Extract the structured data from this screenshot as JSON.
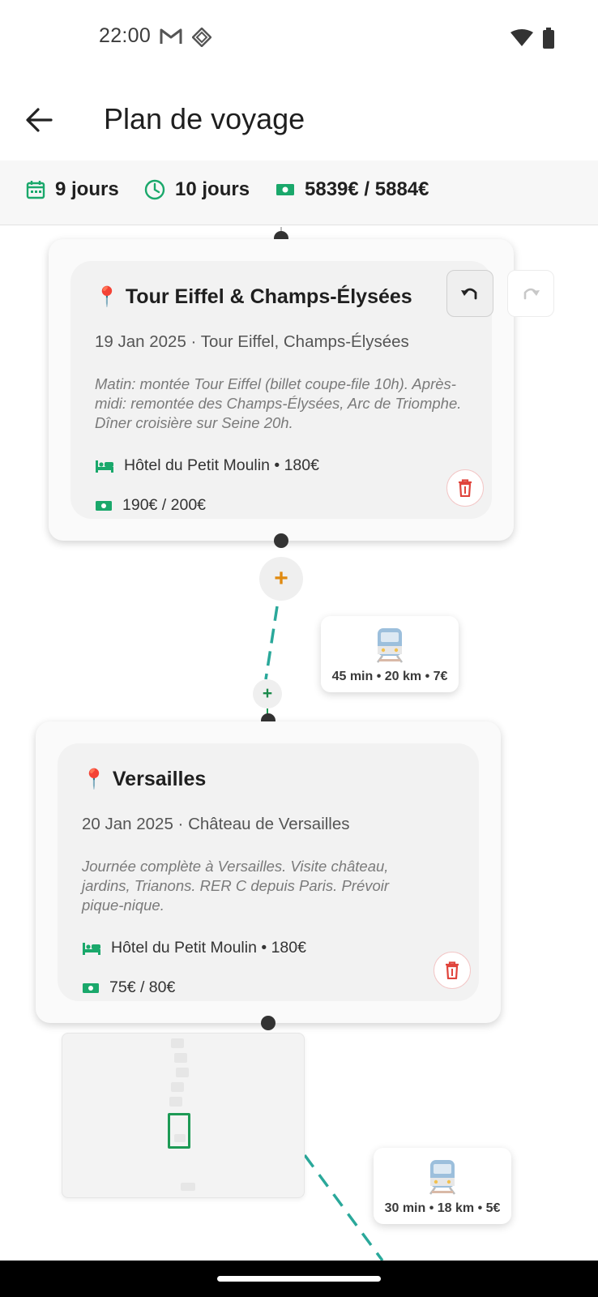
{
  "status_bar": {
    "time": "22:00"
  },
  "app_bar": {
    "title": "Plan de voyage"
  },
  "summary": {
    "days": "9 jours",
    "duration": "10 jours",
    "budget": "5839€ / 5884€",
    "colors": {
      "icon_green": "#1aa86b"
    }
  },
  "days": [
    {
      "title": "Tour Eiffel & Champs-Élysées",
      "meta": "19 Jan 2025 · Tour Eiffel, Champs-Élysées",
      "notes": "Matin: montée Tour Eiffel (billet coupe-file 10h). Après-midi: remontée des Champs-Élysées, Arc de Triomphe. Dîner croisière sur Seine 20h.",
      "hotel": "Hôtel du Petit Moulin • 180€",
      "budget": "190€ / 200€"
    },
    {
      "title": "Versailles",
      "meta": "20 Jan 2025 · Château de Versailles",
      "notes": "Journée complète à Versailles. Visite château, jardins, Trianons. RER C depuis Paris. Prévoir pique-nique.",
      "hotel": "Hôtel du Petit Moulin • 180€",
      "budget": "75€ / 80€"
    }
  ],
  "transports": [
    {
      "label": "45 min • 20 km • 7€",
      "icon": "train-icon"
    },
    {
      "label": "30 min • 18 km • 5€",
      "icon": "train-icon"
    }
  ],
  "buttons": {
    "add_large": "+",
    "add_small": "+"
  },
  "colors": {
    "accent_green": "#1aa86b",
    "dash_teal": "#2aa89a",
    "add_orange": "#e08a10",
    "delete_red": "#e0443c",
    "pin_red": "#e53935"
  }
}
